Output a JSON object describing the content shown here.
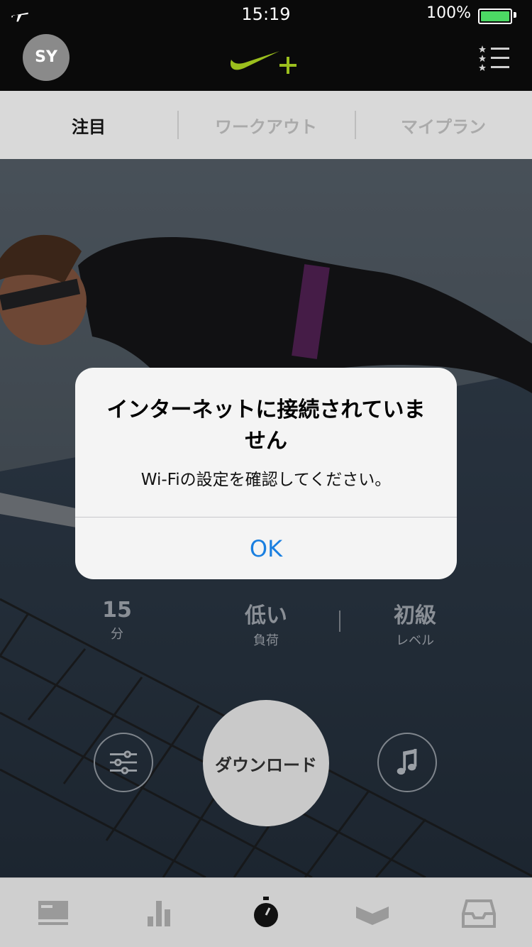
{
  "status_bar": {
    "time": "15:19",
    "battery": "100%"
  },
  "header": {
    "avatar_initials": "SY"
  },
  "tabs": [
    {
      "label": "注目",
      "active": true
    },
    {
      "label": "ワークアウト",
      "active": false
    },
    {
      "label": "マイプラン",
      "active": false
    }
  ],
  "workout": {
    "stats": [
      {
        "value": "15",
        "unit": "分"
      },
      {
        "value": "低い",
        "unit": "負荷"
      },
      {
        "value": "初級",
        "unit": "レベル"
      }
    ],
    "download_label": "ダウンロード"
  },
  "alert": {
    "title": "インターネットに接続されていません",
    "message": "Wi-Fiの設定を確認してください。",
    "ok_label": "OK"
  },
  "colors": {
    "nike_plus": "#9bbf1d",
    "ios_blue": "#1a7fe0",
    "battery_green": "#4cd964"
  }
}
